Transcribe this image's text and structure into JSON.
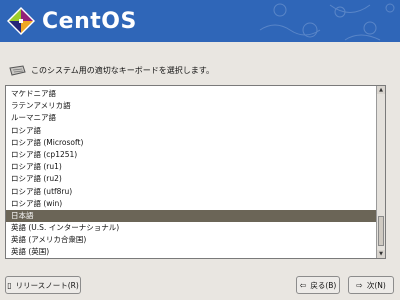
{
  "header": {
    "logo_text": "CentOS"
  },
  "instruction": {
    "text": "このシステム用の適切なキーボードを選択します。"
  },
  "keyboard_list": {
    "items": [
      "マケドニア語",
      "ラテンアメリカ語",
      "ルーマニア語",
      "ロシア語",
      "ロシア語 (Microsoft)",
      "ロシア語 (cp1251)",
      "ロシア語 (ru1)",
      "ロシア語 (ru2)",
      "ロシア語 (utf8ru)",
      "ロシア語 (win)",
      "日本語",
      "英語 (U.S. インターナショナル)",
      "英語 (アメリカ合衆国)",
      "英語 (英国)"
    ],
    "selected": "日本語"
  },
  "buttons": {
    "release_notes": "リリースノート(R)",
    "back": "戻る(B)",
    "next": "次(N)"
  }
}
